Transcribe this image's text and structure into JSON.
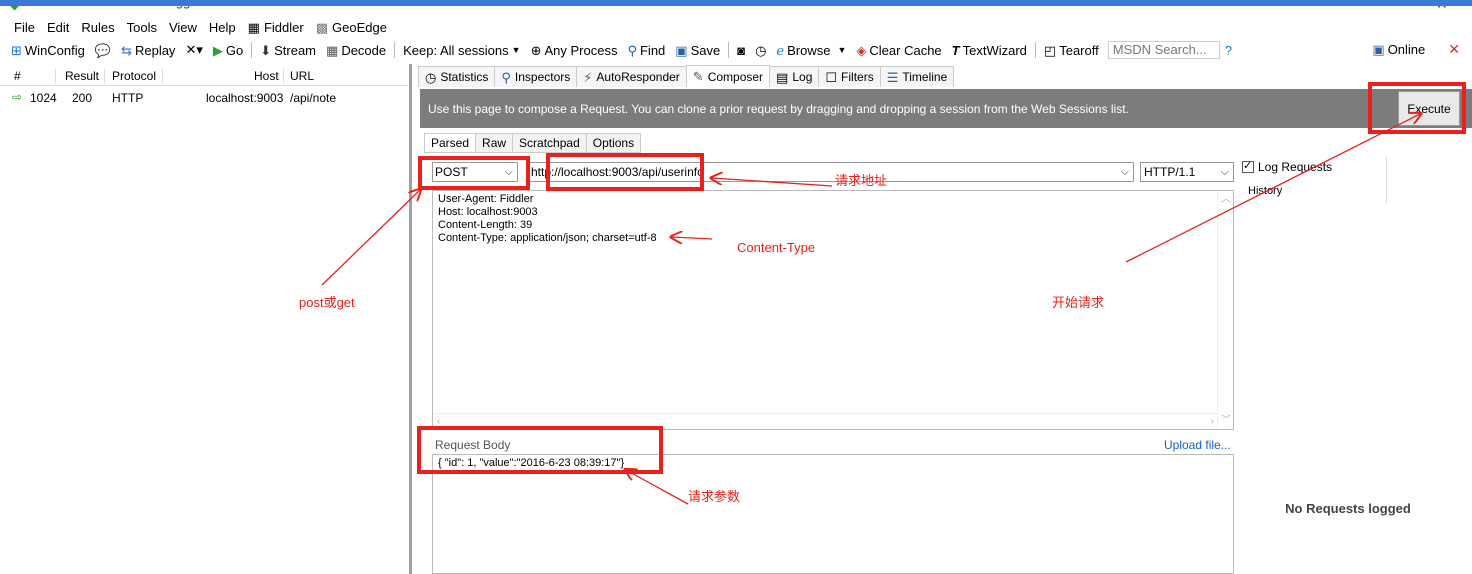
{
  "window": {
    "title": "Telerik Fiddler Web Debugger",
    "minimize": "–",
    "close": "✕"
  },
  "menu": [
    "File",
    "Edit",
    "Rules",
    "Tools",
    "View",
    "Help",
    "Fiddler",
    "GeoEdge"
  ],
  "toolbar": {
    "winconfig": "WinConfig",
    "replay": "Replay",
    "remove": "✕▾",
    "go": "Go",
    "stream": "Stream",
    "decode": "Decode",
    "keep": "Keep: All sessions",
    "any_process": "Any Process",
    "find": "Find",
    "save": "Save",
    "browse": "Browse",
    "clear_cache": "Clear Cache",
    "text_wizard": "TextWizard",
    "tearoff": "Tearoff",
    "search_placeholder": "MSDN Search...",
    "online": "Online"
  },
  "sessions": {
    "columns": [
      "#",
      "Result",
      "Protocol",
      "Host",
      "URL"
    ],
    "rows": [
      {
        "id": "1024",
        "result": "200",
        "protocol": "HTTP",
        "host": "localhost:9003",
        "url": "/api/note"
      }
    ]
  },
  "tabs": [
    "Statistics",
    "Inspectors",
    "AutoResponder",
    "Composer",
    "Log",
    "Filters",
    "Timeline"
  ],
  "composer": {
    "info": "Use this page to compose a Request. You can clone a prior request by dragging and dropping a session from the Web Sessions list.",
    "execute": "Execute",
    "subtabs": [
      "Parsed",
      "Raw",
      "Scratchpad",
      "Options"
    ],
    "method": "POST",
    "url": "http://localhost:9003/api/userinfo",
    "http_version": "HTTP/1.1",
    "headers": [
      "User-Agent: Fiddler",
      "Host: localhost:9003",
      "Content-Length: 39",
      "Content-Type: application/json; charset=utf-8"
    ],
    "request_body_label": "Request Body",
    "upload_link": "Upload file...",
    "body": "{ \"id\": 1, \"value\":\"2016-6-23 08:39:17\"}",
    "log_requests": "Log Requests",
    "history": "History",
    "no_requests": "No Requests logged"
  },
  "annotations": {
    "url": "请求地址",
    "content_type": "Content-Type",
    "method": "post或get",
    "execute": "开始请求",
    "body": "请求参数"
  },
  "colors": {
    "annotation": "#e8211c",
    "infobar": "#7c7c7c",
    "link": "#1a5fc9"
  }
}
